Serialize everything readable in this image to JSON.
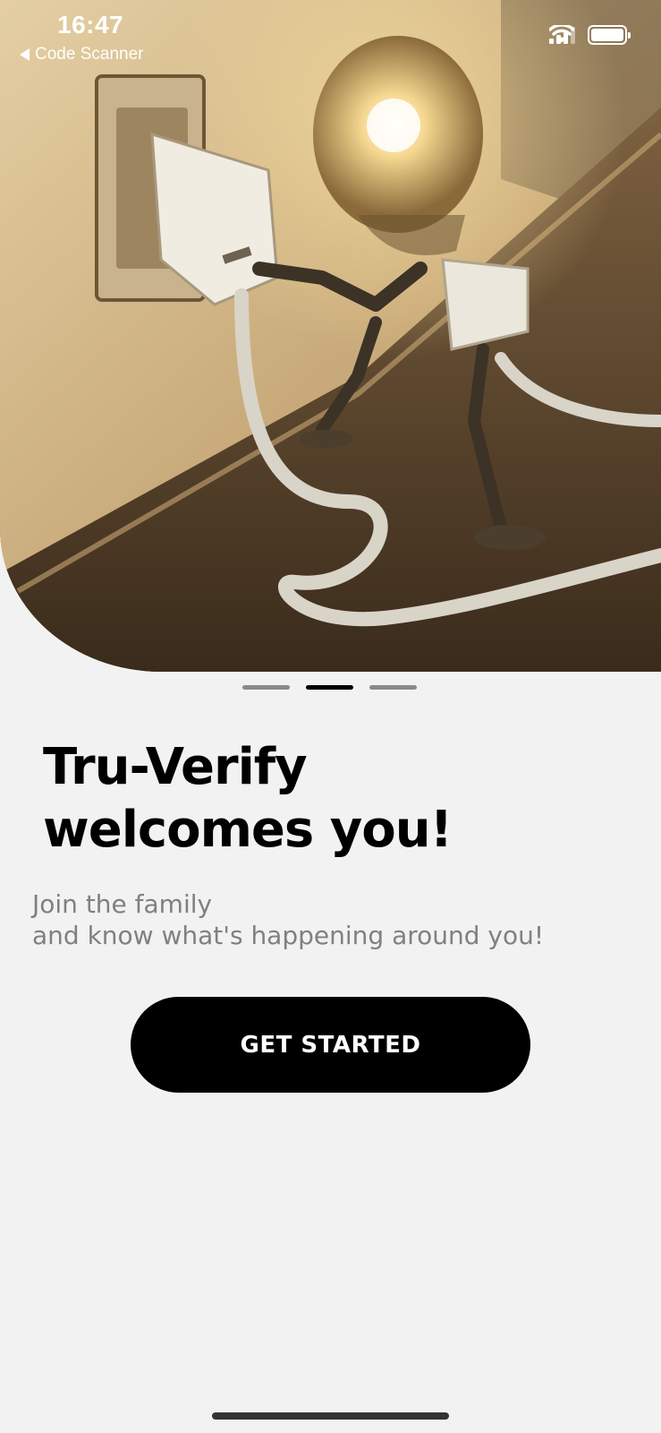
{
  "status_bar": {
    "time": "16:47",
    "back_app": "Code Scanner",
    "signal_icon": "cellular-signal-icon",
    "wifi_icon": "wifi-icon",
    "battery_icon": "battery-icon"
  },
  "onboarding": {
    "hero_image": "lightbulb-robot-plugging-cord-into-wall-socket",
    "page_indicator": {
      "total": 3,
      "active_index": 1
    },
    "title_line1": "Tru-Verify",
    "title_line2": "welcomes you!",
    "subtitle_line1": "Join the family",
    "subtitle_line2": "and know what's happening around you!",
    "cta_label": "GET STARTED"
  },
  "colors": {
    "background": "#f2f2f2",
    "button": "#000000",
    "button_text": "#ffffff",
    "subtitle": "#808080"
  }
}
